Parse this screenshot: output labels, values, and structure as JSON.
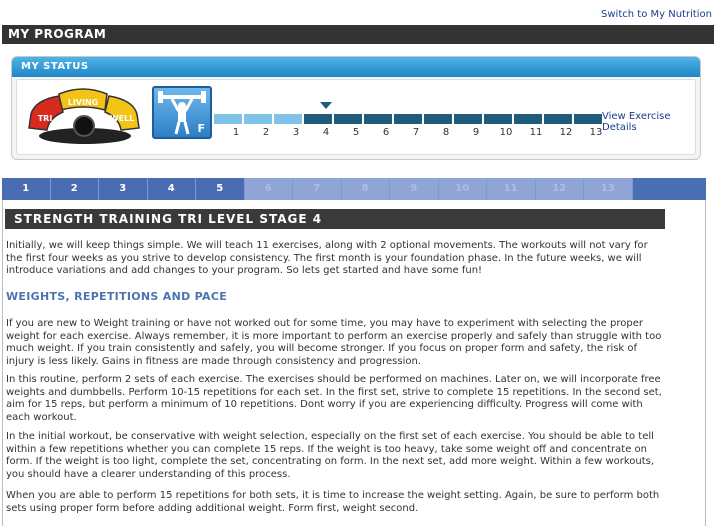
{
  "top_links": {
    "switch_nutrition": "Switch to My Nutrition"
  },
  "page_title": "MY PROGRAM",
  "status": {
    "title": "MY STATUS",
    "logo_words": [
      "LIVING",
      "TRI",
      "WELL"
    ],
    "fitness_icon_letter": "F",
    "progress_steps": [
      "1",
      "2",
      "3",
      "4",
      "5",
      "6",
      "7",
      "8",
      "9",
      "10",
      "11",
      "12",
      "13"
    ],
    "completed_steps": 3,
    "current_step": "4",
    "view_details_link": "View Exercise Details"
  },
  "week_tabs": [
    "1",
    "2",
    "3",
    "4",
    "5",
    "6",
    "7",
    "8",
    "9",
    "10",
    "11",
    "12",
    "13"
  ],
  "active_week_tabs": 5,
  "colors": {
    "header_dark": "#333333",
    "status_blue": "#1f86c7",
    "tab_blue": "#4b6fb5",
    "progress_done": "#7fc3e8",
    "progress_todo": "#1e5b7d",
    "subheading_blue": "#4d74b0"
  },
  "content": {
    "stage_title": "STRENGTH TRAINING TRI LEVEL STAGE 4",
    "intro": "Initially, we will keep things simple. We will teach 11 exercises, along with 2 optional movements. The workouts will not vary for the first four weeks as you strive to develop consistency. The first month is your foundation phase. In the future weeks, we will introduce variations and add changes to your program. So lets get started and have some fun!",
    "subheading": "WEIGHTS, REPETITIONS AND PACE",
    "p1": "If you are new to Weight training or have not worked out for some time, you may have to experiment with selecting the proper weight for each exercise. Always remember, it is more important to perform an exercise properly and safely than struggle with too much weight. If you train consistently and safely, you will become stronger. If you focus on proper form and safety, the risk of injury is less likely. Gains in fitness are made through consistency and progression.",
    "p2": "In this routine, perform 2 sets of each exercise. The exercises should be performed on machines. Later on, we will incorporate free weights and dumbbells. Perform 10-15 repetitions for each set. In the first set, strive to complete 15 repetitions. In the second set, aim for 15 reps, but perform a minimum of 10 repetitions. Dont worry if you are experiencing difficulty. Progress will come with each workout.",
    "p3": "In the initial workout, be conservative with weight selection, especially on the first set of each exercise. You should be able to tell within a few repetitions whether you can complete 15 reps. If the weight is too heavy, take some weight off and concentrate on form. If the weight is too light, complete the set, concentrating on form. In the next set, add more weight. Within a few workouts, you should have a clearer understanding of this process.",
    "p4": "When you are able to perform 15 repetitions for both sets, it is time to increase the weight setting. Again, be sure to perform both sets using proper form before adding additional weight. Form first, weight second."
  }
}
